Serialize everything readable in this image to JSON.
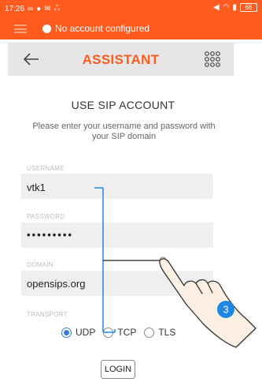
{
  "status_bar": {
    "time": "17:26",
    "battery": "66"
  },
  "notification": {
    "text": "No account configured"
  },
  "toolbar": {
    "title": "ASSISTANT"
  },
  "form": {
    "title": "USE SIP ACCOUNT",
    "instructions": "Please enter your username and password with your SIP domain",
    "username": {
      "label": "USERNAME",
      "value": "vtk1"
    },
    "password": {
      "label": "PASSWORD",
      "value": "•••••••••"
    },
    "domain": {
      "label": "DOMAIN",
      "value": "opensips.org"
    },
    "transport": {
      "label": "TRANSPORT",
      "options": [
        "UDP",
        "TCP",
        "TLS"
      ],
      "selected": "UDP"
    },
    "login_label": "LOGIN"
  },
  "annotation": {
    "step_number": "3",
    "accent_color": "#1e88e5"
  },
  "colors": {
    "brand": "#ff5b1f",
    "toolbar_bg": "#e6e6e6",
    "field_bg": "#efefef",
    "radio_selected": "#3a7bd5"
  }
}
